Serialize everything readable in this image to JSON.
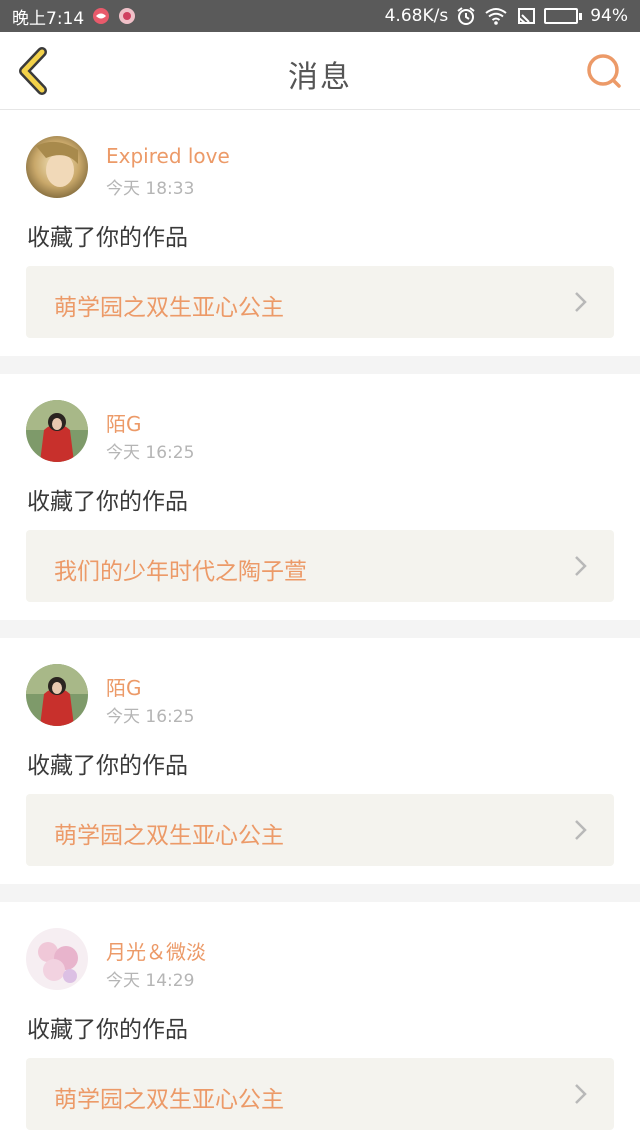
{
  "status_bar": {
    "time": "晚上7:14",
    "network_speed": "4.68K/s",
    "battery": "94%",
    "battery_level": 0.94,
    "battery_color": "#39d63a",
    "icons": [
      "app-icon",
      "app-icon",
      "alarm-icon",
      "wifi-icon",
      "cast-icon",
      "battery-icon"
    ]
  },
  "header": {
    "title": "消息",
    "back_icon": "chevron-left-icon",
    "search_icon": "search-icon",
    "accent_color": "#ec9a68"
  },
  "messages": [
    {
      "username": "Expired love",
      "time": "今天 18:33",
      "action": "收藏了你的作品",
      "work_title": "萌学园之双生亚心公主"
    },
    {
      "username": "陌G",
      "time": "今天 16:25",
      "action": "收藏了你的作品",
      "work_title": "我们的少年时代之陶子萱"
    },
    {
      "username": "陌G",
      "time": "今天 16:25",
      "action": "收藏了你的作品",
      "work_title": "萌学园之双生亚心公主"
    },
    {
      "username": "月光＆微淡",
      "time": "今天 14:29",
      "action": "收藏了你的作品",
      "work_title": "萌学园之双生亚心公主"
    }
  ]
}
